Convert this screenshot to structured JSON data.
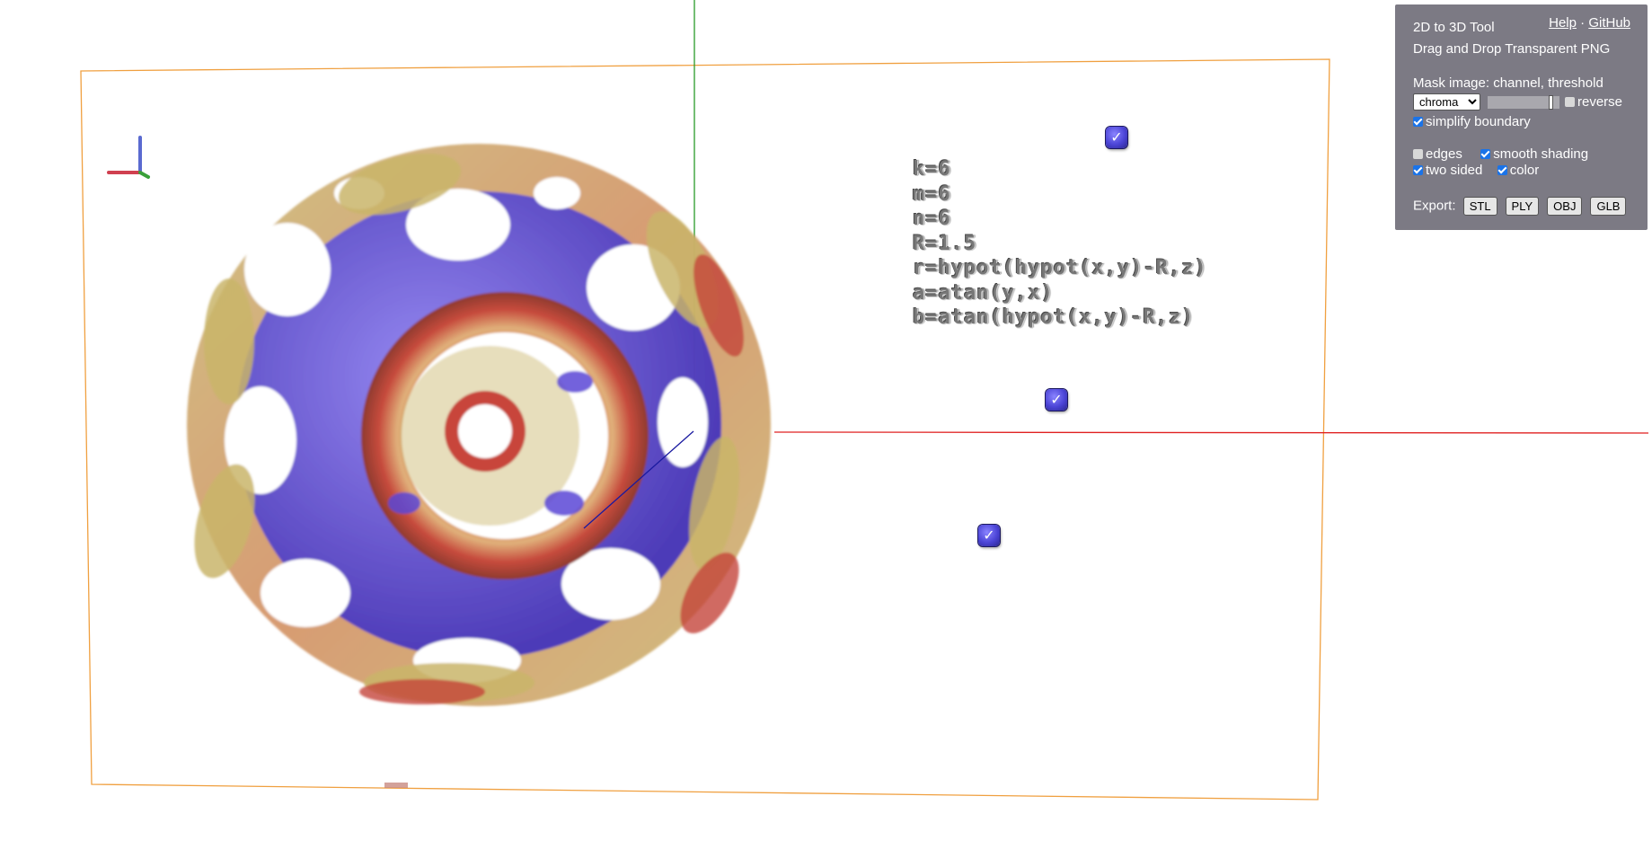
{
  "formula_lines": [
    "k=6",
    "m=6",
    "n=6",
    "R=1.5",
    "r=hypot(hypot(x,y)-R,z)",
    "a=atan(y,x)",
    "b=atan(hypot(x,y)-R,z)"
  ],
  "panel": {
    "title": "2D to 3D Tool",
    "subtitle": "Drag and Drop Transparent PNG",
    "help_link": "Help",
    "separator": "·",
    "github_link": "GitHub",
    "mask_label": "Mask image: channel, threshold",
    "channel_options": [
      "chroma"
    ],
    "channel_selected": "chroma",
    "threshold_level": 0.9,
    "reverse_label": "reverse",
    "reverse_checked": false,
    "simplify_label": "simplify boundary",
    "simplify_checked": true,
    "edges_label": "edges",
    "edges_checked": false,
    "smooth_label": "smooth shading",
    "smooth_checked": true,
    "two_sided_label": "two sided",
    "two_sided_checked": true,
    "color_label": "color",
    "color_checked": true,
    "export_label": "Export:",
    "export_buttons": [
      "STL",
      "PLY",
      "OBJ",
      "GLB"
    ]
  },
  "handles": [
    "✓",
    "✓",
    "✓"
  ],
  "colors": {
    "panel_bg": "#7c7a84",
    "frame": "#f0a040",
    "axis_x": "#e02020",
    "axis_y": "#2a9a2a",
    "axis_z": "#1a1aa0",
    "mesh_warm": "#d0553f",
    "mesh_gold": "#c9b56a",
    "mesh_purple": "#5b47d6"
  }
}
